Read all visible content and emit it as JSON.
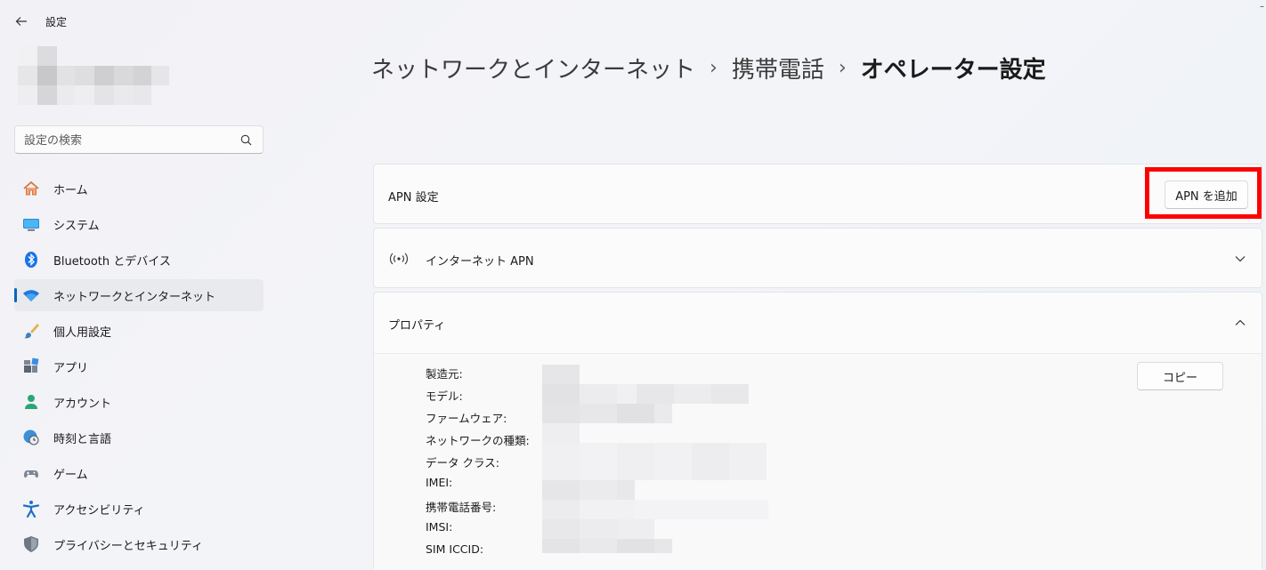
{
  "window": {
    "app_title": "設定"
  },
  "search": {
    "placeholder": "設定の検索"
  },
  "nav": {
    "items": [
      {
        "label": "ホーム",
        "icon": "home-icon"
      },
      {
        "label": "システム",
        "icon": "monitor-icon"
      },
      {
        "label": "Bluetooth とデバイス",
        "icon": "bluetooth-icon"
      },
      {
        "label": "ネットワークとインターネット",
        "icon": "wifi-icon",
        "active": true
      },
      {
        "label": "個人用設定",
        "icon": "paintbrush-icon"
      },
      {
        "label": "アプリ",
        "icon": "apps-icon"
      },
      {
        "label": "アカウント",
        "icon": "person-icon"
      },
      {
        "label": "時刻と言語",
        "icon": "globe-clock-icon"
      },
      {
        "label": "ゲーム",
        "icon": "gamepad-icon"
      },
      {
        "label": "アクセシビリティ",
        "icon": "accessibility-icon"
      },
      {
        "label": "プライバシーとセキュリティ",
        "icon": "shield-icon"
      }
    ]
  },
  "breadcrumb": {
    "level1": "ネットワークとインターネット",
    "level2": "携帯電話",
    "current": "オペレーター設定",
    "separator": "›"
  },
  "apn_settings": {
    "label": "APN 設定",
    "add_button": "APN を追加"
  },
  "internet_apn": {
    "label": "インターネット APN"
  },
  "properties": {
    "label": "プロパティ",
    "copy_button": "コピー",
    "rows": [
      "製造元:",
      "モデル:",
      "ファームウェア:",
      "ネットワークの種類:",
      "データ クラス:",
      "IMEI:",
      "携帯電話番号:",
      "IMSI:",
      "SIM ICCID:"
    ]
  },
  "colors": {
    "accent": "#0067c0",
    "highlight": "#ff0000"
  }
}
